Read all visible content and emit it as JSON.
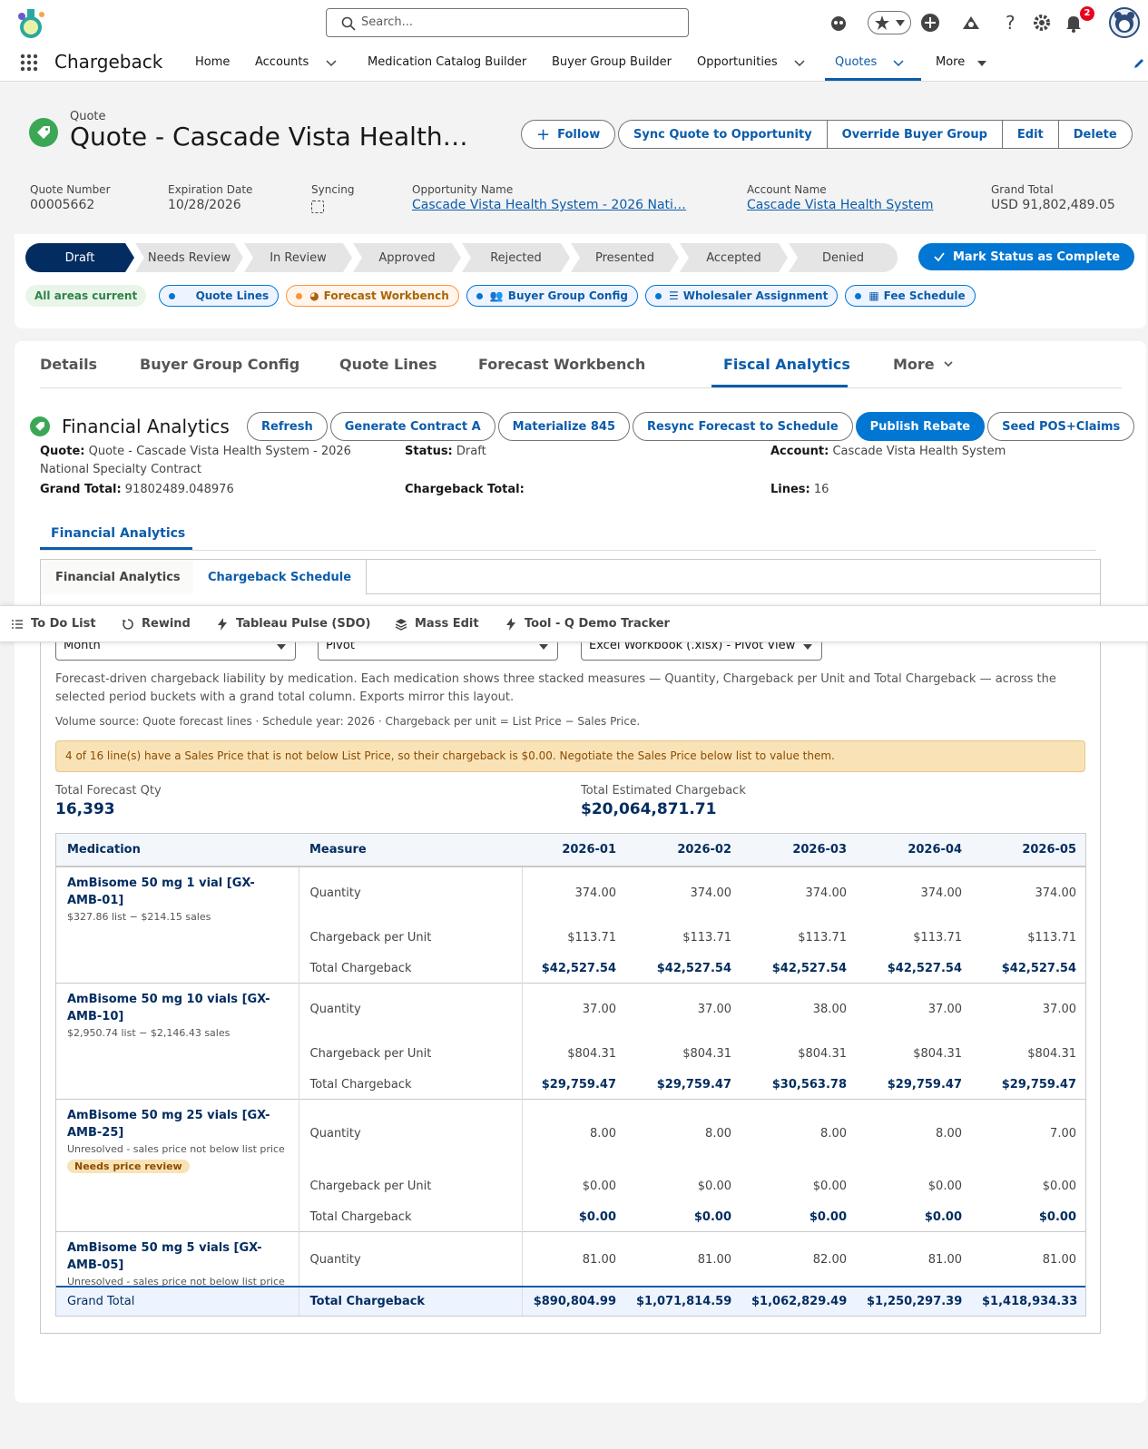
{
  "header": {
    "search_placeholder": "Search...",
    "notification_count": "2"
  },
  "nav": {
    "app_name": "Chargeback",
    "items": [
      "Home",
      "Accounts",
      "Medication Catalog Builder",
      "Buyer Group Builder",
      "Opportunities",
      "Quotes",
      "More"
    ]
  },
  "record": {
    "type": "Quote",
    "title": "Quote - Cascade Vista Health…",
    "follow_label": "Follow",
    "actions": [
      "Sync Quote to Opportunity",
      "Override Buyer Group",
      "Edit",
      "Delete"
    ],
    "fields": {
      "quote_number_label": "Quote Number",
      "quote_number": "00005662",
      "expiration_label": "Expiration Date",
      "expiration": "10/28/2026",
      "syncing_label": "Syncing",
      "opportunity_label": "Opportunity Name",
      "opportunity": "Cascade Vista Health System - 2026 Nati…",
      "account_label": "Account Name",
      "account": "Cascade Vista Health System",
      "grand_total_label": "Grand Total",
      "grand_total": "USD 91,802,489.05"
    }
  },
  "path": {
    "steps": [
      "Draft",
      "Needs Review",
      "In Review",
      "Approved",
      "Rejected",
      "Presented",
      "Accepted",
      "Denied"
    ],
    "current": "Draft",
    "mark_complete": "Mark Status as Complete"
  },
  "chips": {
    "all_current": "All areas current",
    "items": [
      "Quote Lines",
      "Forecast Workbench",
      "Buyer Group Config",
      "Wholesaler Assignment",
      "Fee Schedule"
    ]
  },
  "tabs": [
    "Details",
    "Buyer Group Config",
    "Quote Lines",
    "Forecast Workbench",
    "Fiscal Analytics",
    "More"
  ],
  "analytics": {
    "title": "Financial Analytics",
    "buttons": [
      "Refresh",
      "Generate Contract A",
      "Materialize 845",
      "Resync Forecast to Schedule",
      "Publish Rebate",
      "Seed POS+Claims"
    ],
    "quote_label": "Quote:",
    "quote_value": "Quote - Cascade Vista Health System - 2026",
    "quote_value2": "National Specialty Contract",
    "status_label": "Status:",
    "status_value": "Draft",
    "account_label": "Account:",
    "account_value": "Cascade Vista Health System",
    "grand_total_label": "Grand Total:",
    "grand_total_value": "91802489.048976",
    "chargeback_total_label": "Chargeback Total:",
    "lines_label": "Lines:",
    "lines_value": "16",
    "subtab": "Financial Analytics",
    "inner_tabs": [
      "Financial Analytics",
      "Chargeback Schedule"
    ]
  },
  "utility": [
    "To Do List",
    "Rewind",
    "Tableau Pulse (SDO)",
    "Mass Edit",
    "Tool - Q Demo Tracker"
  ],
  "schedule": {
    "period": "Month",
    "layout": "Pivot",
    "export": "Excel Workbook (.xlsx) - Pivot View",
    "description": "Forecast-driven chargeback liability by medication. Each medication shows three stacked measures — Quantity, Chargeback per Unit and Total Chargeback — across the selected period buckets with a grand total column. Exports mirror this layout.",
    "source_note": "Volume source: Quote forecast lines · Schedule year: 2026 · Chargeback per unit = List Price − Sales Price.",
    "warning": "4 of 16 line(s) have a Sales Price that is not below List Price, so their chargeback is $0.00. Negotiate the Sales Price below list to value them.",
    "total_qty_label": "Total Forecast Qty",
    "total_qty": "16,393",
    "total_cb_label": "Total Estimated Chargeback",
    "total_cb": "$20,064,871.71",
    "columns": [
      "Medication",
      "Measure",
      "2026-01",
      "2026-02",
      "2026-03",
      "2026-04",
      "2026-05"
    ],
    "measures": [
      "Quantity",
      "Chargeback per Unit",
      "Total Chargeback"
    ],
    "rows": [
      {
        "name": "AmBisome 50 mg 1 vial [GX-AMB-01]",
        "sub": "$327.86 list − $214.15 sales",
        "qty": [
          "374.00",
          "374.00",
          "374.00",
          "374.00",
          "374.00"
        ],
        "cpu": [
          "$113.71",
          "$113.71",
          "$113.71",
          "$113.71",
          "$113.71"
        ],
        "total": [
          "$42,527.54",
          "$42,527.54",
          "$42,527.54",
          "$42,527.54",
          "$42,527.54"
        ]
      },
      {
        "name": "AmBisome 50 mg 10 vials [GX-AMB-10]",
        "sub": "$2,950.74 list − $2,146.43 sales",
        "qty": [
          "37.00",
          "37.00",
          "38.00",
          "37.00",
          "37.00"
        ],
        "cpu": [
          "$804.31",
          "$804.31",
          "$804.31",
          "$804.31",
          "$804.31"
        ],
        "total": [
          "$29,759.47",
          "$29,759.47",
          "$30,563.78",
          "$29,759.47",
          "$29,759.47"
        ]
      },
      {
        "name": "AmBisome 50 mg 25 vials [GX-AMB-25]",
        "sub": "Unresolved - sales price not below list price",
        "badge": "Needs price review",
        "qty": [
          "8.00",
          "8.00",
          "8.00",
          "8.00",
          "7.00"
        ],
        "cpu": [
          "$0.00",
          "$0.00",
          "$0.00",
          "$0.00",
          "$0.00"
        ],
        "total": [
          "$0.00",
          "$0.00",
          "$0.00",
          "$0.00",
          "$0.00"
        ]
      },
      {
        "name": "AmBisome 50 mg 5 vials [GX-AMB-05]",
        "sub": "Unresolved - sales price not below list price",
        "qty": [
          "81.00",
          "81.00",
          "82.00",
          "81.00",
          "81.00"
        ]
      }
    ],
    "grand_label": "Grand Total",
    "grand_measure": "Total Chargeback",
    "grand_values": [
      "$890,804.99",
      "$1,071,814.59",
      "$1,062,829.49",
      "$1,250,297.39",
      "$1,418,934.33"
    ]
  }
}
